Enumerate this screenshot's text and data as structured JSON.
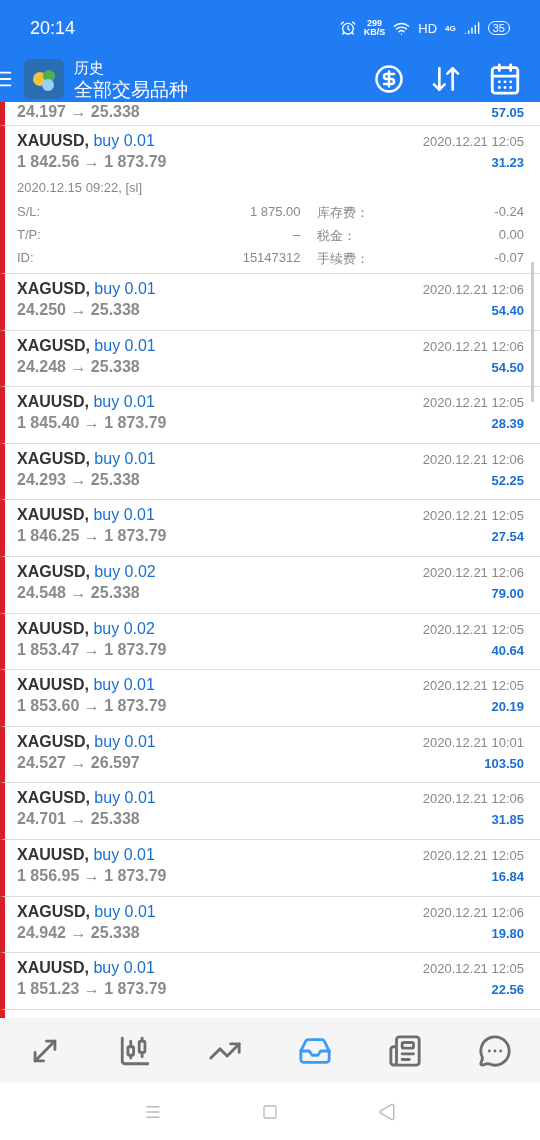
{
  "status_bar": {
    "time": "20:14",
    "speed": "299",
    "speed_unit": "KB/S",
    "hd": "HD",
    "network": "4G",
    "battery": "35"
  },
  "app_bar": {
    "title": "历史",
    "subtitle": "全部交易品种"
  },
  "trades": [
    {
      "kind": "partial",
      "prices": "24.197 → 25.338",
      "profit": "57.05"
    },
    {
      "kind": "expanded",
      "symbol": "XAUUSD,",
      "type": "buy 0.01",
      "time": "2020.12.21 12:05",
      "prices": "1 842.56 → 1 873.79",
      "profit": "31.23",
      "open_info": "2020.12.15 09:22, [sl]",
      "fields": [
        {
          "label": "S/L:",
          "value": "1 875.00"
        },
        {
          "label": "T/P:",
          "value": "–"
        },
        {
          "label": "ID:",
          "value": "15147312"
        }
      ],
      "charges": [
        {
          "label": "库存费：",
          "value": "-0.24"
        },
        {
          "label": "税金：",
          "value": "0.00"
        },
        {
          "label": "手续费：",
          "value": "-0.07"
        }
      ]
    },
    {
      "kind": "row",
      "symbol": "XAGUSD,",
      "type": "buy 0.01",
      "time": "2020.12.21 12:06",
      "prices": "24.250 → 25.338",
      "profit": "54.40"
    },
    {
      "kind": "row",
      "symbol": "XAGUSD,",
      "type": "buy 0.01",
      "time": "2020.12.21 12:06",
      "prices": "24.248 → 25.338",
      "profit": "54.50"
    },
    {
      "kind": "row",
      "symbol": "XAUUSD,",
      "type": "buy 0.01",
      "time": "2020.12.21 12:05",
      "prices": "1 845.40 → 1 873.79",
      "profit": "28.39"
    },
    {
      "kind": "row",
      "symbol": "XAGUSD,",
      "type": "buy 0.01",
      "time": "2020.12.21 12:06",
      "prices": "24.293 → 25.338",
      "profit": "52.25"
    },
    {
      "kind": "row",
      "symbol": "XAUUSD,",
      "type": "buy 0.01",
      "time": "2020.12.21 12:05",
      "prices": "1 846.25 → 1 873.79",
      "profit": "27.54"
    },
    {
      "kind": "row",
      "symbol": "XAGUSD,",
      "type": "buy 0.02",
      "time": "2020.12.21 12:06",
      "prices": "24.548 → 25.338",
      "profit": "79.00"
    },
    {
      "kind": "row",
      "symbol": "XAUUSD,",
      "type": "buy 0.02",
      "time": "2020.12.21 12:05",
      "prices": "1 853.47 → 1 873.79",
      "profit": "40.64"
    },
    {
      "kind": "row",
      "symbol": "XAUUSD,",
      "type": "buy 0.01",
      "time": "2020.12.21 12:05",
      "prices": "1 853.60 → 1 873.79",
      "profit": "20.19"
    },
    {
      "kind": "row",
      "symbol": "XAGUSD,",
      "type": "buy 0.01",
      "time": "2020.12.21 10:01",
      "prices": "24.527 → 26.597",
      "profit": "103.50"
    },
    {
      "kind": "row",
      "symbol": "XAGUSD,",
      "type": "buy 0.01",
      "time": "2020.12.21 12:06",
      "prices": "24.701 → 25.338",
      "profit": "31.85"
    },
    {
      "kind": "row",
      "symbol": "XAUUSD,",
      "type": "buy 0.01",
      "time": "2020.12.21 12:05",
      "prices": "1 856.95 → 1 873.79",
      "profit": "16.84"
    },
    {
      "kind": "row",
      "symbol": "XAGUSD,",
      "type": "buy 0.01",
      "time": "2020.12.21 12:06",
      "prices": "24.942 → 25.338",
      "profit": "19.80"
    },
    {
      "kind": "row",
      "symbol": "XAUUSD,",
      "type": "buy 0.01",
      "time": "2020.12.21 12:05",
      "prices": "1 851.23 → 1 873.79",
      "profit": "22.56"
    },
    {
      "kind": "hidden"
    }
  ],
  "bottom_nav": [
    {
      "kind": "quotes",
      "selected": false
    },
    {
      "kind": "chart",
      "selected": false
    },
    {
      "kind": "trade",
      "selected": false
    },
    {
      "kind": "history",
      "selected": true
    },
    {
      "kind": "news",
      "selected": false
    },
    {
      "kind": "chat",
      "selected": false
    }
  ]
}
